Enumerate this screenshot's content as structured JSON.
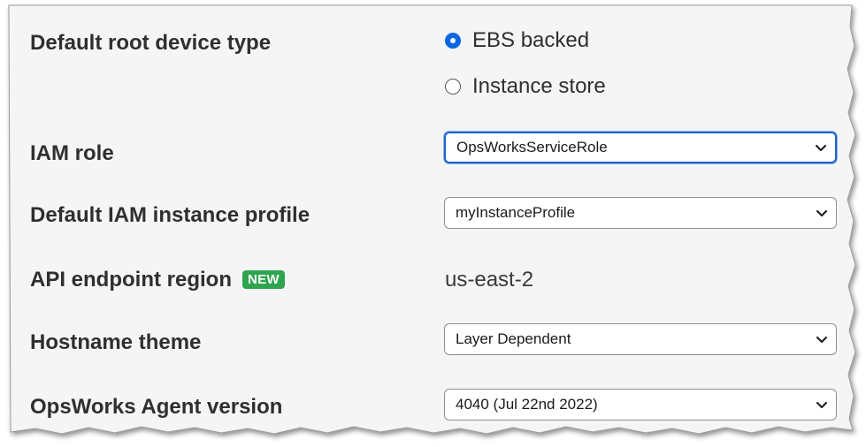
{
  "rows": {
    "root_device": {
      "label": "Default root device type",
      "options": [
        "EBS backed",
        "Instance store"
      ],
      "selected": "EBS backed"
    },
    "iam_role": {
      "label": "IAM role",
      "value": "OpsWorksServiceRole"
    },
    "instance_profile": {
      "label": "Default IAM instance profile",
      "value": "myInstanceProfile"
    },
    "api_region": {
      "label": "API endpoint region",
      "badge": "NEW",
      "value": "us-east-2"
    },
    "hostname_theme": {
      "label": "Hostname theme",
      "value": "Layer Dependent"
    },
    "agent_version": {
      "label": "OpsWorks Agent version",
      "value": "4040 (Jul 22nd 2022)"
    }
  },
  "colors": {
    "radio_selected": "#0b66e4",
    "badge_bg": "#2ea44f",
    "focus_border": "#1e63c6",
    "panel_bg": "#f5f5f5"
  },
  "icons": {
    "select_chevron": "chevron-down-icon"
  }
}
